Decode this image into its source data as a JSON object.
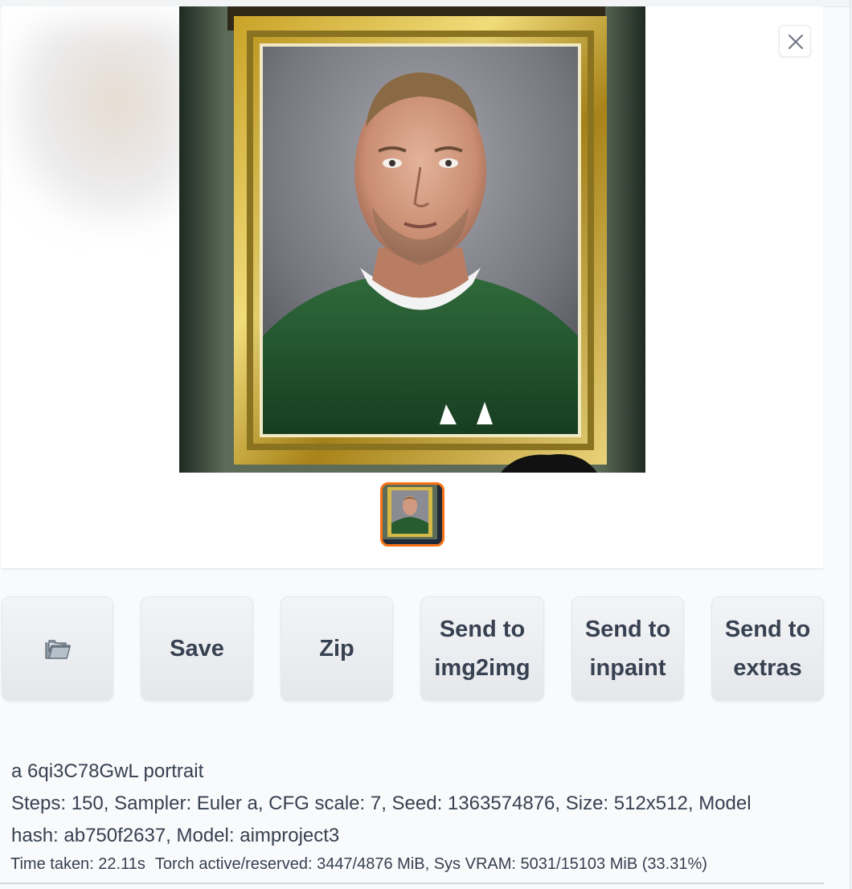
{
  "gallery": {
    "close_label": "close",
    "image_description": "",
    "thumbnail_count": 1
  },
  "actions": {
    "folder_icon": "folder-icon",
    "save": "Save",
    "zip": "Zip",
    "send_img2img": "Send to\nimg2img",
    "send_inpaint": "Send to\ninpaint",
    "send_extras": "Send to\nextras"
  },
  "generation_info": {
    "prompt": "a 6qi3C78GwL portrait",
    "params_line1": "Steps: 150, Sampler: Euler a, CFG scale: 7, Seed: 1363574876, Size: 512x512, Model",
    "params_line2": "hash: ab750f2637, Model: aimproject3"
  },
  "timing": {
    "time_taken": "Time taken: 22.11s",
    "memory": "Torch active/reserved: 3447/4876 MiB, Sys VRAM: 5031/15103 MiB (33.31%)"
  },
  "colors": {
    "accent": "#f97316",
    "button_bg": "#f3f4f6",
    "text": "#374151"
  }
}
